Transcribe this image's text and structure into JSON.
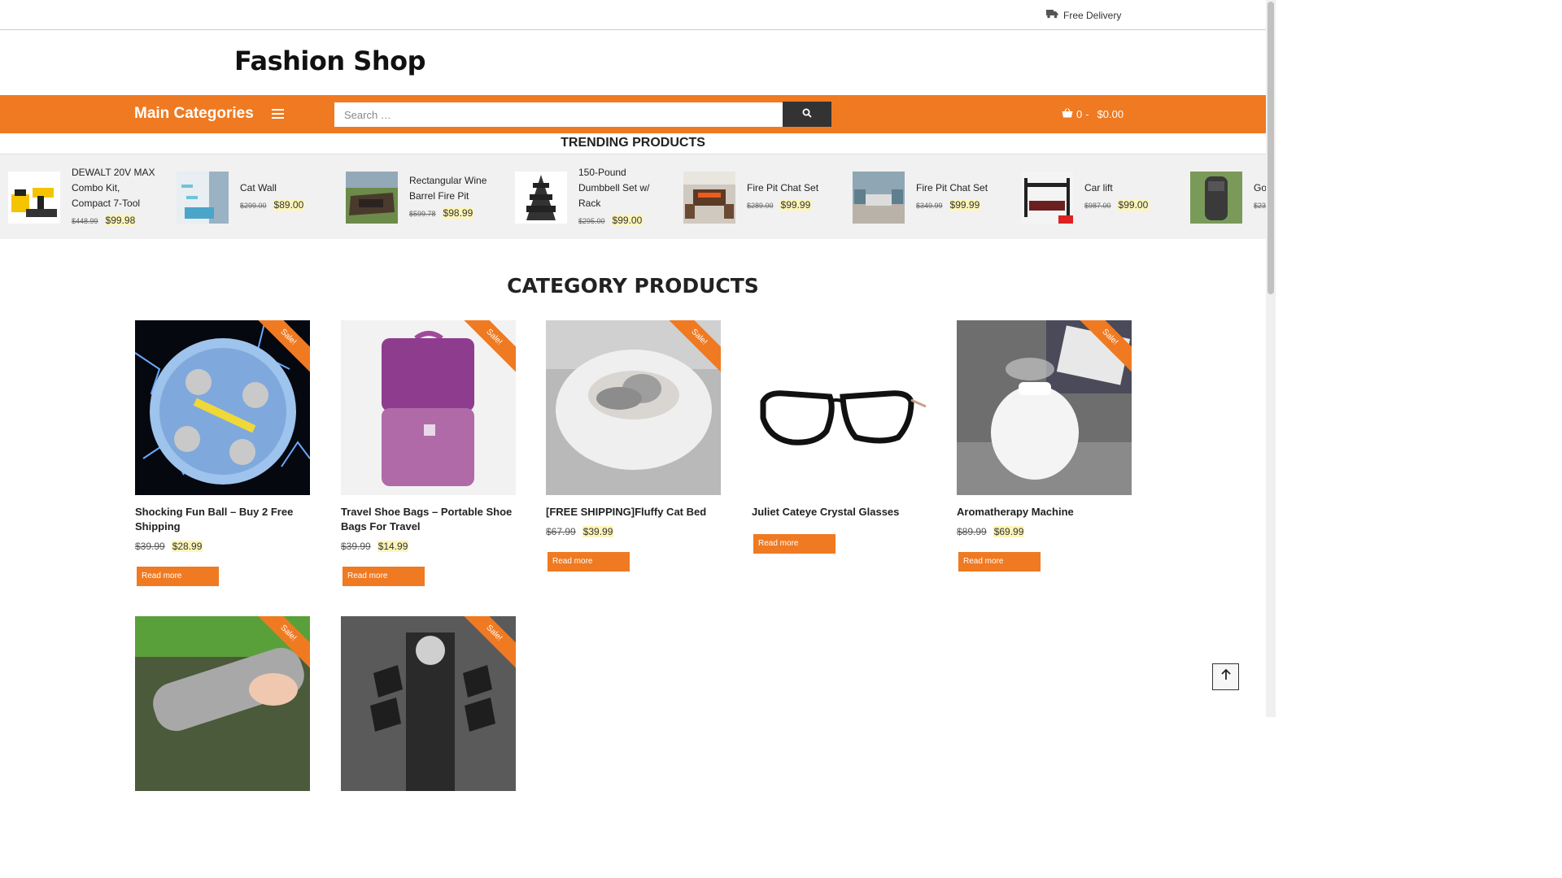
{
  "topbar": {
    "delivery_label": "Free Delivery"
  },
  "header": {
    "brand": "Fashion Shop"
  },
  "nav": {
    "main_categories": "Main Categories"
  },
  "search": {
    "placeholder": "Search …"
  },
  "cart": {
    "count": "0",
    "total": "$0.00"
  },
  "trending": {
    "title": "TRENDING PRODUCTS",
    "items": [
      {
        "name": "DEWALT 20V MAX Combo Kit, Compact 7-Tool",
        "old": "$448.99",
        "new": "$99.98"
      },
      {
        "name": "Cat Wall",
        "old": "$299.00",
        "new": "$89.00"
      },
      {
        "name": "Rectangular Wine Barrel Fire Pit",
        "old": "$599.78",
        "new": "$98.99"
      },
      {
        "name": "150-Pound Dumbbell Set w/ Rack",
        "old": "$295.00",
        "new": "$99.00"
      },
      {
        "name": "Fire Pit Chat Set",
        "old": "$289.00",
        "new": "$99.99"
      },
      {
        "name": "Fire Pit Chat Set",
        "old": "$349.99",
        "new": "$99.99"
      },
      {
        "name": "Car lift",
        "old": "$987.00",
        "new": "$99.00"
      },
      {
        "name": "Go",
        "old": "$23",
        "new": ""
      }
    ]
  },
  "category": {
    "title": "CATEGORY PRODUCTS",
    "sale_label": "Sale!",
    "read_more": "Read more",
    "products": [
      {
        "name": "Shocking Fun Ball – Buy 2 Free Shipping",
        "old": "$39.99",
        "new": "$28.99"
      },
      {
        "name": "Travel Shoe Bags – Portable Shoe Bags For Travel",
        "old": "$39.99",
        "new": "$14.99"
      },
      {
        "name": "[FREE SHIPPING]Fluffy Cat Bed",
        "old": "$67.99",
        "new": "$39.99"
      },
      {
        "name": "Juliet Cateye Crystal Glasses",
        "old": "",
        "new": ""
      },
      {
        "name": "Aromatherapy Machine",
        "old": "$89.99",
        "new": "$69.99"
      }
    ]
  },
  "colors": {
    "accent": "#ef7a22",
    "dark": "#333333",
    "price_highlight": "#fdf5b8"
  }
}
